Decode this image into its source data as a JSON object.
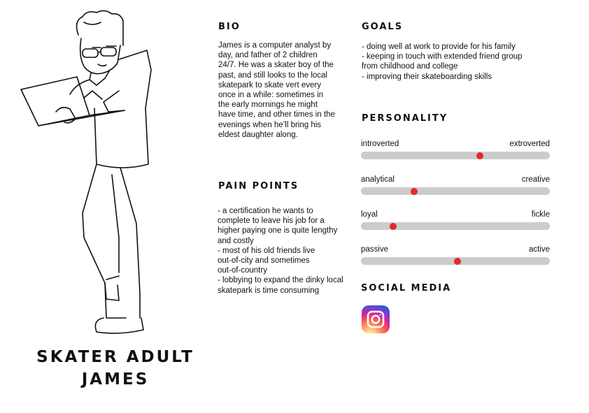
{
  "persona": {
    "name_line1": "SKATER ADULT",
    "name_line2": "JAMES"
  },
  "bio": {
    "heading": "BIO",
    "lines": [
      "James is a computer analyst by",
      "day, and father of 2 children",
      "24/7. He was a skater boy of the",
      "past, and still looks to the local",
      "skatepark to skate vert every",
      "once in a while: sometimes in",
      "the early mornings he might",
      "have time, and other times in the",
      "evenings when he’ll bring his",
      "eldest daughter along."
    ]
  },
  "pain_points": {
    "heading": "PAIN POINTS",
    "lines": [
      "- a certification he wants to",
      "complete to leave his job for a",
      "higher paying one is quite lengthy",
      "and costly",
      "- most of his old friends live",
      "out-of-city and sometimes",
      "out-of-country",
      "- lobbying to expand the dinky local",
      "skatepark is time consuming"
    ]
  },
  "goals": {
    "heading": "GOALS",
    "lines": [
      "- doing well at work to provide for his family",
      "- keeping in touch with extended friend group",
      "from childhood and college",
      "- improving their skateboarding skills"
    ]
  },
  "personality": {
    "heading": "PERSONALITY",
    "scales": [
      {
        "left": "introverted",
        "right": "extroverted",
        "value": 0.63
      },
      {
        "left": "analytical",
        "right": "creative",
        "value": 0.28
      },
      {
        "left": "loyal",
        "right": "fickle",
        "value": 0.17
      },
      {
        "left": "passive",
        "right": "active",
        "value": 0.51
      }
    ],
    "knob_color": "#e02a2a",
    "track_color": "#cccccc"
  },
  "social": {
    "heading": "SOCIAL MEDIA",
    "icons": [
      "instagram-icon"
    ]
  }
}
